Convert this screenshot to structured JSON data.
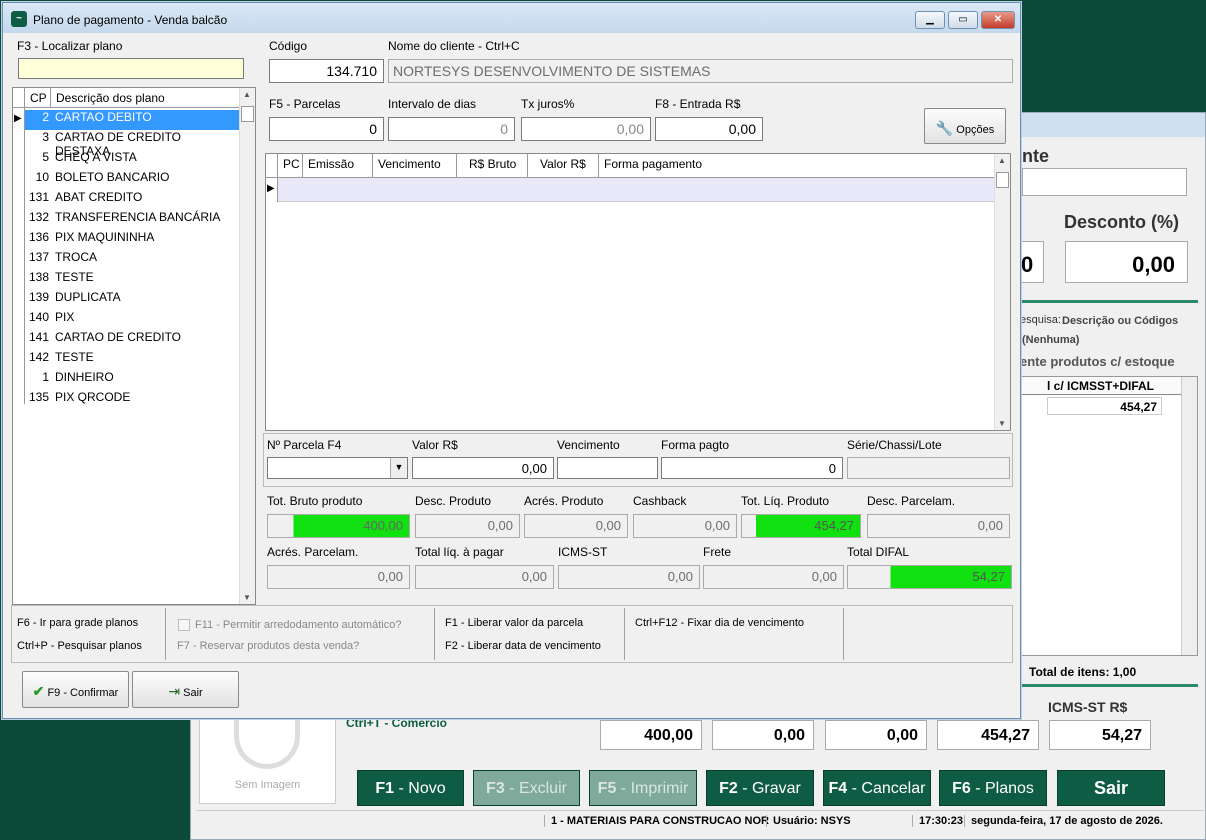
{
  "background_window": {
    "heading_partial": "nte",
    "desconto_label": "Desconto (%)",
    "desconto_value": "0,00",
    "left_box_value": "0",
    "pesquisa_label": "esquisa:",
    "pesquisa_value": "Descrição ou Códigos",
    "nenhuma": "(Nenhuma)",
    "estoque": "ente produtos c/ estoque",
    "grid_header": "l c/ ICMSST+DIFAL",
    "grid_value": "454,27",
    "total_itens": "Total de itens: 1,00",
    "icms_label": "ICMS-ST R$",
    "ctrl_hint": "Ctrl+T - Comércio",
    "sem_imagem": "Sem Imagem",
    "totals": [
      "400,00",
      "0,00",
      "0,00",
      "454,27",
      "54,27"
    ],
    "buttons": [
      {
        "key": "F1",
        "label": " - Novo",
        "enabled": true
      },
      {
        "key": "F3",
        "label": " - Excluir",
        "enabled": false
      },
      {
        "key": "F5",
        "label": " - Imprimir",
        "enabled": false
      },
      {
        "key": "F2",
        "label": " - Gravar",
        "enabled": true
      },
      {
        "key": "F4",
        "label": " - Cancelar",
        "enabled": true
      },
      {
        "key": "F6",
        "label": " - Planos",
        "enabled": true
      },
      {
        "key": "",
        "label": "Sair",
        "enabled": true
      }
    ],
    "status": {
      "empresa": "1 - MATERIAIS PARA CONSTRUCAO NOR",
      "usuario": "Usuário: NSYS",
      "hora": "17:30:23",
      "data": "segunda-feira, 17 de agosto de 2026."
    }
  },
  "dialog": {
    "title": "Plano de pagamento - Venda balcão",
    "localizar_label": "F3 - Localizar plano",
    "localizar_value": "",
    "codigo_label": "Código",
    "codigo_value": "134.710",
    "cliente_label": "Nome do cliente - Ctrl+C",
    "cliente_value": "NORTESYS DESENVOLVIMENTO DE SISTEMAS",
    "parcelas_label": "F5 - Parcelas",
    "parcelas_value": "0",
    "intervalo_label": "Intervalo de dias",
    "intervalo_value": "0",
    "juros_label": "Tx juros%",
    "juros_value": "0,00",
    "entrada_label": "F8 - Entrada R$",
    "entrada_value": "0,00",
    "opcoes_label": "Opções",
    "plans_header": {
      "cp": "CP",
      "desc": "Descrição dos plano"
    },
    "plans": [
      {
        "cp": "2",
        "desc": "CARTAO DEBITO"
      },
      {
        "cp": "3",
        "desc": "CARTAO DE CREDITO DESTAXA"
      },
      {
        "cp": "5",
        "desc": "CHEQ A VISTA"
      },
      {
        "cp": "10",
        "desc": "BOLETO BANCARIO"
      },
      {
        "cp": "131",
        "desc": "ABAT CREDITO"
      },
      {
        "cp": "132",
        "desc": "TRANSFERENCIA BANCÁRIA"
      },
      {
        "cp": "136",
        "desc": "PIX MAQUININHA"
      },
      {
        "cp": "137",
        "desc": "TROCA"
      },
      {
        "cp": "138",
        "desc": "TESTE"
      },
      {
        "cp": "139",
        "desc": "DUPLICATA"
      },
      {
        "cp": "140",
        "desc": "PIX"
      },
      {
        "cp": "141",
        "desc": "CARTAO DE CREDITO"
      },
      {
        "cp": "142",
        "desc": "TESTE"
      },
      {
        "cp": "1",
        "desc": "DINHEIRO"
      },
      {
        "cp": "135",
        "desc": "PIX QRCODE"
      }
    ],
    "parcel_headers": [
      "PC",
      "Emissão",
      "Vencimento",
      "R$ Bruto",
      "Valor R$",
      "Forma pagamento"
    ],
    "parcela_label": "Nº Parcela F4",
    "valor_label": "Valor R$",
    "valor_value": "0,00",
    "vencimento_label": "Vencimento",
    "forma_label": "Forma pagto",
    "forma_value": "0",
    "serie_label": "Série/Chassi/Lote",
    "totals_row1": [
      {
        "label": "Tot. Bruto produto",
        "value": "400,00"
      },
      {
        "label": "Desc. Produto",
        "value": "0,00"
      },
      {
        "label": "Acrés. Produto",
        "value": "0,00"
      },
      {
        "label": "Cashback",
        "value": "0,00"
      },
      {
        "label": "Tot. Líq. Produto",
        "value": "454,27"
      },
      {
        "label": "Desc. Parcelam.",
        "value": "0,00"
      }
    ],
    "totals_row2": [
      {
        "label": "Acrés. Parcelam.",
        "value": "0,00"
      },
      {
        "label": "Total líq. à pagar",
        "value": "0,00"
      },
      {
        "label": "ICMS-ST",
        "value": "0,00"
      },
      {
        "label": "Frete",
        "value": "0,00"
      },
      {
        "label": "Total DIFAL",
        "value": "54,27"
      }
    ],
    "hints": {
      "f6": "F6 - Ir para grade planos",
      "ctrlp": "Ctrl+P - Pesquisar planos",
      "f11": "F11 - Permitir arredodamento automático?",
      "f7": "F7 - Reservar produtos desta venda?",
      "f1": "F1 - Liberar valor da parcela",
      "f2": "F2 - Liberar data de vencimento",
      "ctrlf12": "Ctrl+F12 - Fixar dia de vencimento"
    },
    "confirm_label": "F9 - Confirmar",
    "exit_label": "Sair"
  }
}
